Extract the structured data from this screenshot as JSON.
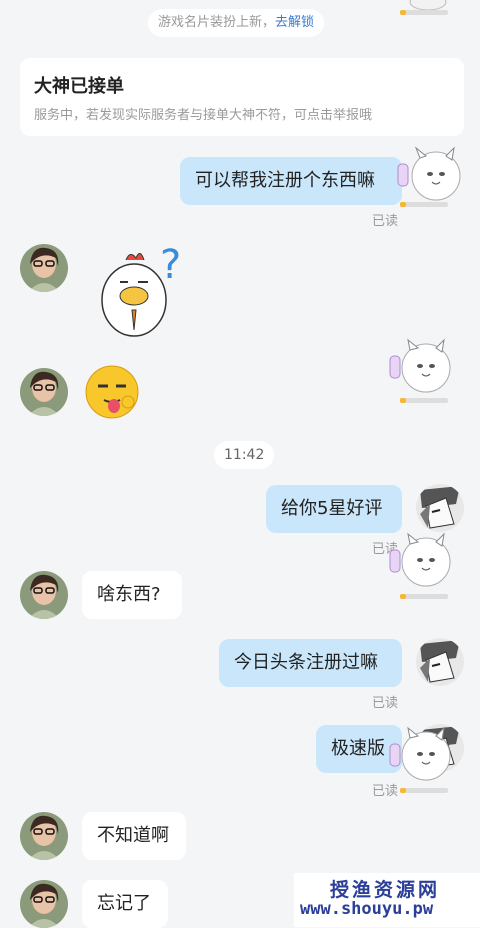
{
  "system_notice": {
    "text": "游戏名片装扮上新，",
    "link": "去解锁"
  },
  "service_card": {
    "title": "大神已接单",
    "subtitle": "服务中，若发现实际服务者与接单大神不符，可点击举报哦"
  },
  "timestamp": "11:42",
  "messages": [
    {
      "side": "me",
      "text": "可以帮我注册个东西嘛",
      "status": "已读"
    },
    {
      "side": "them",
      "type": "sticker",
      "sticker": "chicken-question-sticker"
    },
    {
      "side": "me",
      "type": "sticker",
      "sticker": "white-cat-sticker"
    },
    {
      "side": "them",
      "type": "sticker",
      "sticker": "tongue-emoji-sticker"
    },
    {
      "side": "me",
      "text": "给你5星好评",
      "status": "已读"
    },
    {
      "side": "them",
      "text": "啥东西?"
    },
    {
      "side": "me",
      "text": "今日头条注册过嘛",
      "status": "已读"
    },
    {
      "side": "me",
      "text": "极速版",
      "status": "已读"
    },
    {
      "side": "them",
      "text": "不知道啊"
    },
    {
      "side": "them",
      "text": "忘记了"
    }
  ],
  "watermark": {
    "line1": "授渔资源网",
    "line2": "www.shouyu.pw"
  },
  "colors": {
    "my_bubble": "#c9e6fb",
    "their_bubble": "#ffffff",
    "link": "#3a7bd5",
    "watermark": "#2a3e9a"
  }
}
